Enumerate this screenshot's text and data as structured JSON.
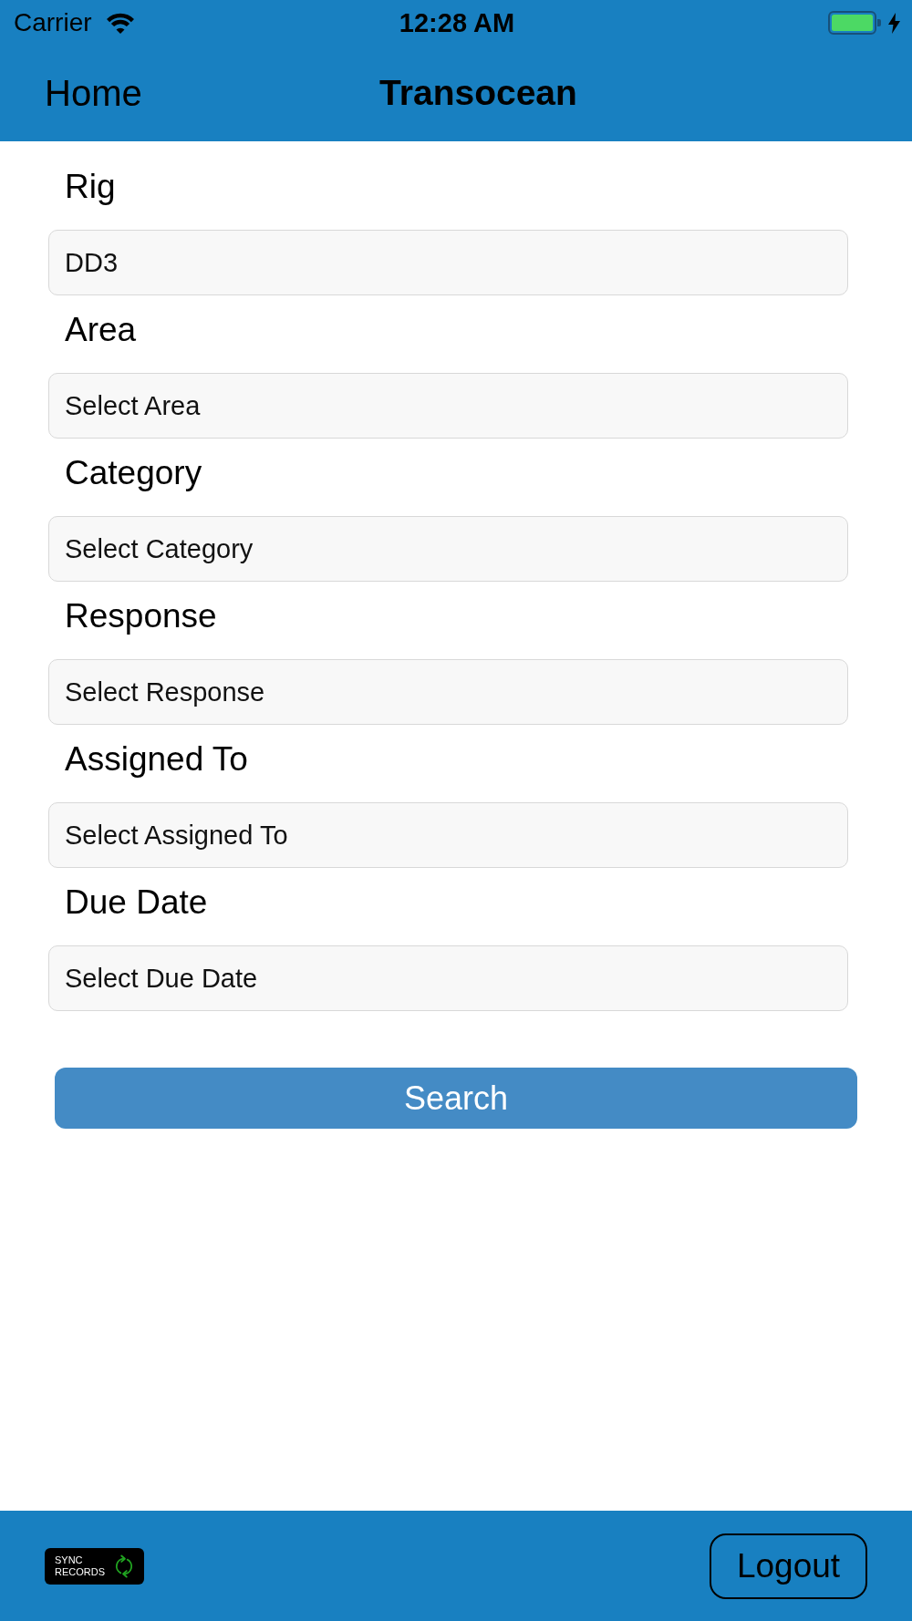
{
  "status_bar": {
    "carrier": "Carrier",
    "time": "12:28 AM",
    "charging": true
  },
  "nav_bar": {
    "back": "Home",
    "title": "Transocean"
  },
  "fields": [
    {
      "label": "Rig",
      "value": "DD3"
    },
    {
      "label": "Area",
      "placeholder": "Select Area"
    },
    {
      "label": "Category",
      "placeholder": "Select Category"
    },
    {
      "label": "Response",
      "placeholder": "Select Response"
    },
    {
      "label": "Assigned To",
      "placeholder": "Select Assigned To"
    },
    {
      "label": "Due Date",
      "placeholder": "Select Due Date"
    }
  ],
  "search_button": "Search",
  "footer": {
    "sync_button": "SYNC RECORDS",
    "logout_button": "Logout"
  }
}
